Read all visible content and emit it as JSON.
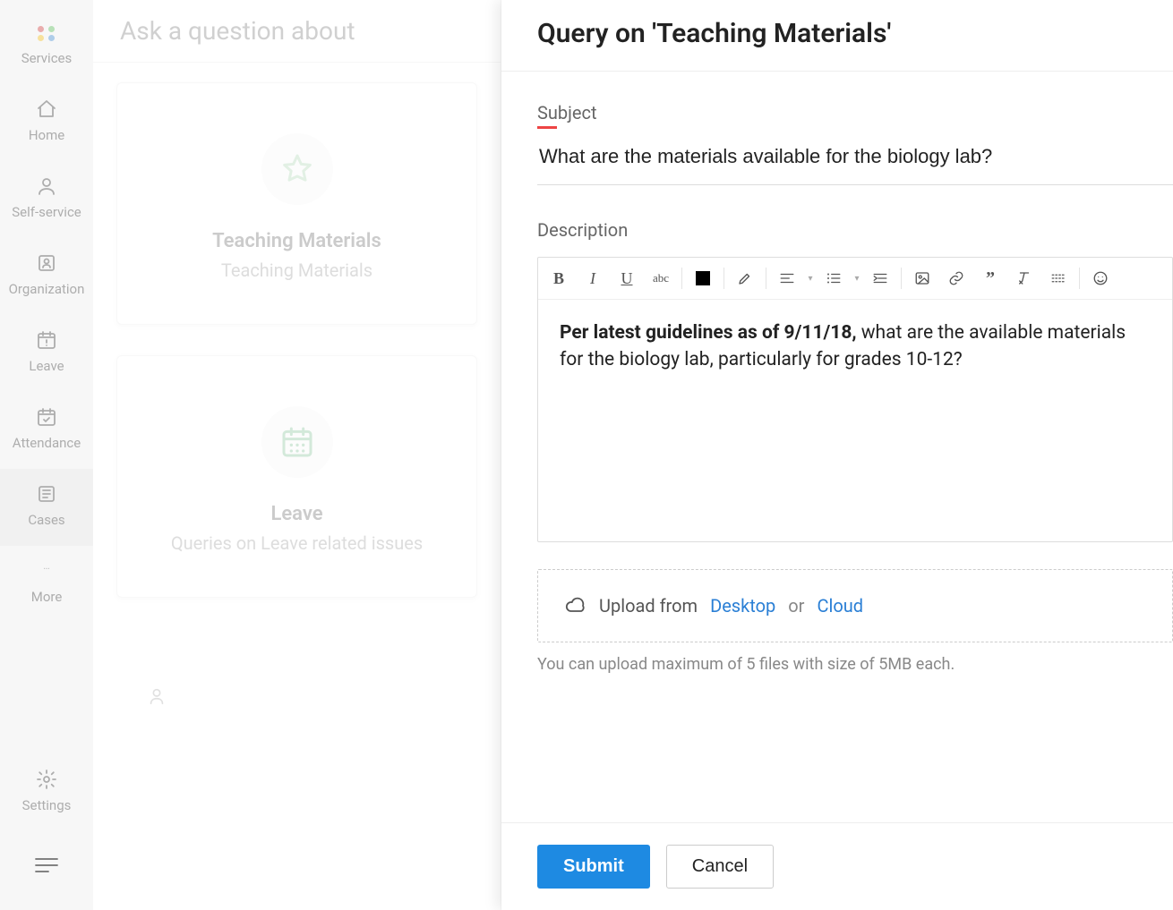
{
  "nav": {
    "items": [
      {
        "label": "Services"
      },
      {
        "label": "Home"
      },
      {
        "label": "Self-service"
      },
      {
        "label": "Organization"
      },
      {
        "label": "Leave"
      },
      {
        "label": "Attendance"
      },
      {
        "label": "Cases"
      },
      {
        "label": "More"
      }
    ],
    "settings_label": "Settings"
  },
  "mid": {
    "header": "Ask a question about",
    "cards": [
      {
        "title": "Teaching Materials",
        "subtitle": "Teaching Materials"
      },
      {
        "title": "Leave",
        "subtitle": "Queries on Leave related issues"
      }
    ]
  },
  "panel": {
    "title": "Query on 'Teaching Materials'",
    "subject_label": "Subject",
    "subject_value": "What are the materials available for the biology lab?",
    "description_label": "Description",
    "description_bold": "Per latest guidelines as of 9/11/18,",
    "description_rest": " what are the available materials for the biology lab, particularly for grades 10-12?",
    "upload_prefix": "Upload from",
    "upload_desktop": "Desktop",
    "upload_or": "or",
    "upload_cloud": "Cloud",
    "upload_hint": "You can upload maximum of 5 files with size of 5MB each.",
    "submit": "Submit",
    "cancel": "Cancel"
  }
}
